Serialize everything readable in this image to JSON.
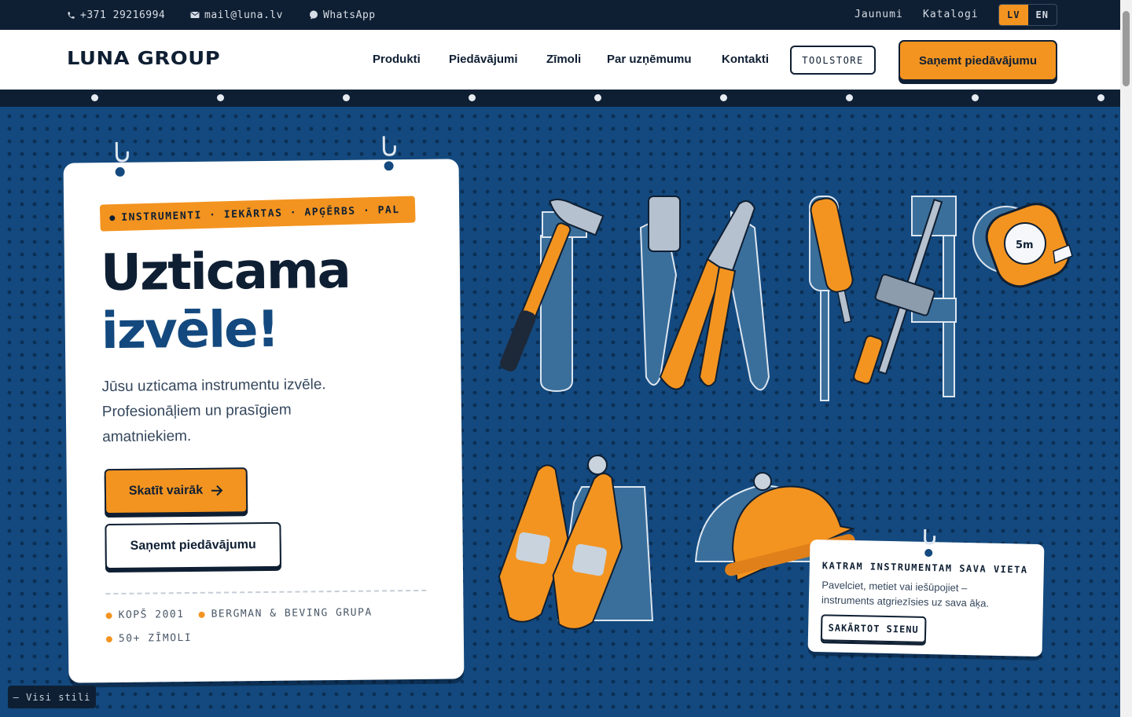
{
  "topbar": {
    "phone": "+371 29216994",
    "email": "mail@luna.lv",
    "whatsapp": "WhatsApp",
    "links": [
      "Jaunumi",
      "Katalogi"
    ],
    "lang": [
      "LV",
      "EN"
    ],
    "active_lang": "LV"
  },
  "header": {
    "logo": "LUNA GROUP",
    "nav": [
      "Produkti",
      "Piedāvājumi",
      "Zīmoli",
      "Par uzņēmumu",
      "Kontakti"
    ],
    "toolstore": "TOOLSTORE",
    "cta": "Saņemt piedāvājumu"
  },
  "hero": {
    "tagline": "INSTRUMENTI · IEKĀRTAS · APĢĒRBS · PAL",
    "title_line1": "Uzticama",
    "title_line2": "izvēle!",
    "lead": "Jūsu uzticama instrumentu izvēle. Profesionāļiem un prasīgiem amatniekiem.",
    "primary_button": "Skatīt vairāk",
    "secondary_button": "Saņemt piedāvājumu",
    "stats": [
      "KOPŠ 2001",
      "BERGMAN & BEVING GRUPA",
      "50+ ZĪMOLI"
    ]
  },
  "note": {
    "title": "KATRAM INSTRUMENTAM SAVA VIETA",
    "text": "Pavelciet, metiet vai iešūpojiet – instruments atgriezīsies uz sava āķa.",
    "button": "SAKĀRTOT SIENU"
  },
  "tape_label": "5m",
  "styles_chip": "— Visi stili",
  "colors": {
    "accent": "#f39420",
    "navy": "#0f1f33",
    "board": "#13497e",
    "silhouette": "#3a6f9c"
  }
}
